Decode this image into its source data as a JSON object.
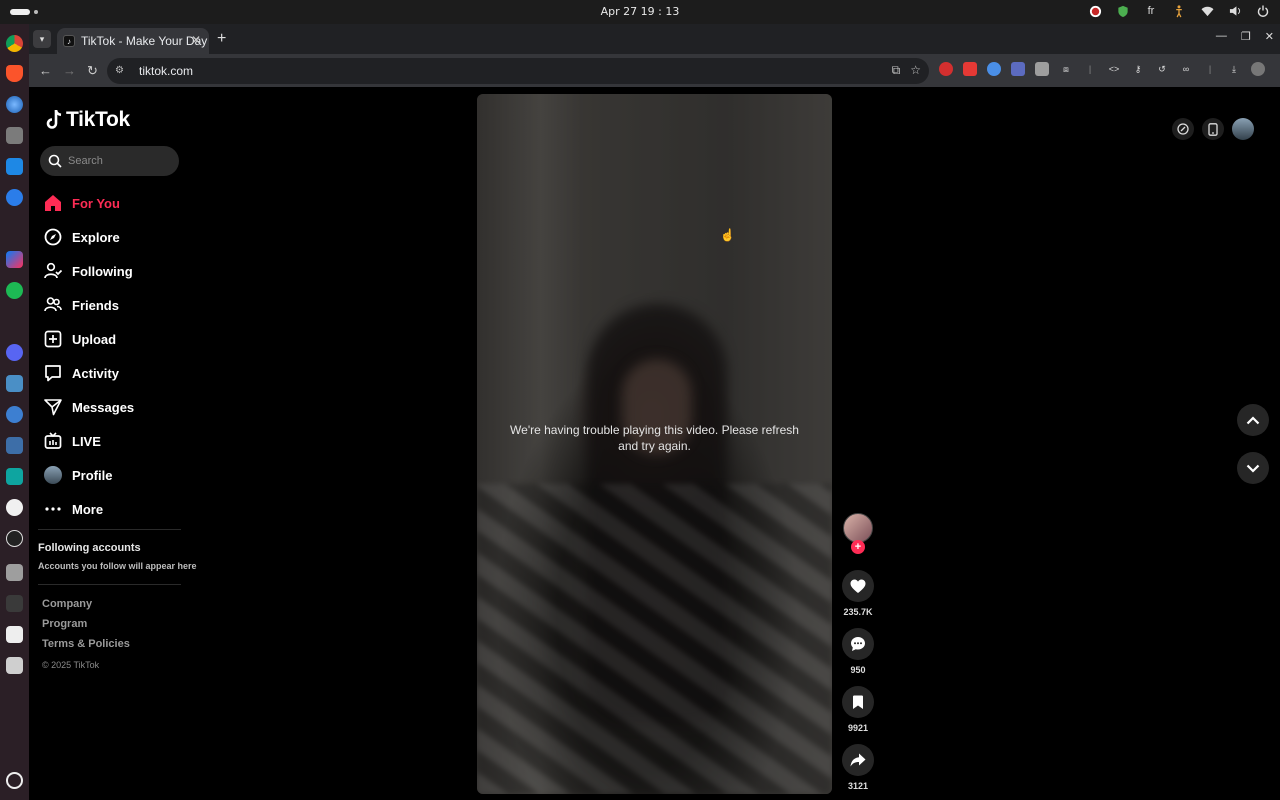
{
  "os": {
    "clock": "Apr 27  19 : 13",
    "lang": "fr"
  },
  "browser": {
    "tab_title": "TikTok - Make Your Day",
    "url": "tiktok.com"
  },
  "tiktok": {
    "logo_text": "TikTok",
    "search_placeholder": "Search",
    "nav": [
      {
        "label": "For You",
        "icon": "home-icon",
        "active": true
      },
      {
        "label": "Explore",
        "icon": "compass-icon"
      },
      {
        "label": "Following",
        "icon": "following-icon"
      },
      {
        "label": "Friends",
        "icon": "friends-icon"
      },
      {
        "label": "Upload",
        "icon": "upload-icon"
      },
      {
        "label": "Activity",
        "icon": "activity-icon"
      },
      {
        "label": "Messages",
        "icon": "messages-icon"
      },
      {
        "label": "LIVE",
        "icon": "live-icon"
      },
      {
        "label": "Profile",
        "icon": "avatar"
      },
      {
        "label": "More",
        "icon": "more-icon"
      }
    ],
    "following_title": "Following accounts",
    "following_sub": "Accounts you follow will appear here",
    "footer": {
      "company": "Company",
      "program": "Program",
      "terms": "Terms & Policies",
      "copyright": "© 2025 TikTok"
    },
    "video": {
      "error_message": "We're having trouble playing this video. Please refresh and try again."
    },
    "actions": {
      "likes": "235.7K",
      "comments": "950",
      "saves": "9921",
      "shares": "3121"
    }
  },
  "colors": {
    "accent": "#fe2c55",
    "background": "#000000"
  }
}
